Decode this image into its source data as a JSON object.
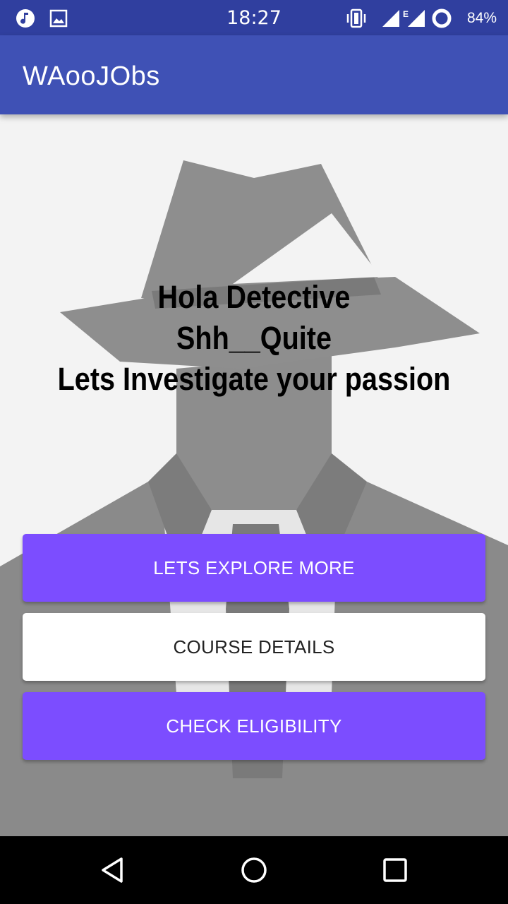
{
  "status_bar": {
    "time": "18:27",
    "battery_percent": "84%",
    "left_icons": [
      "music-note-icon",
      "image-icon"
    ],
    "right_icons": [
      "vibrate-icon",
      "signal-icon",
      "signal-e-icon",
      "battery-ring-icon"
    ],
    "network_letter": "E"
  },
  "app_bar": {
    "title": "WAooJObs"
  },
  "main": {
    "headline_lines": [
      "Hola Detective",
      "Shh__Quite",
      "Lets Investigate your passion"
    ],
    "buttons": {
      "explore": "LETS EXPLORE MORE",
      "course": "COURSE DETAILS",
      "eligibility": "CHECK ELIGIBILITY"
    }
  },
  "nav_bar": {
    "icons": [
      "back-icon",
      "home-icon",
      "recents-icon"
    ]
  },
  "colors": {
    "status_bar": "#303f9f",
    "app_bar": "#3f51b5",
    "accent_button": "#7c4dff",
    "white_button": "#ffffff"
  }
}
